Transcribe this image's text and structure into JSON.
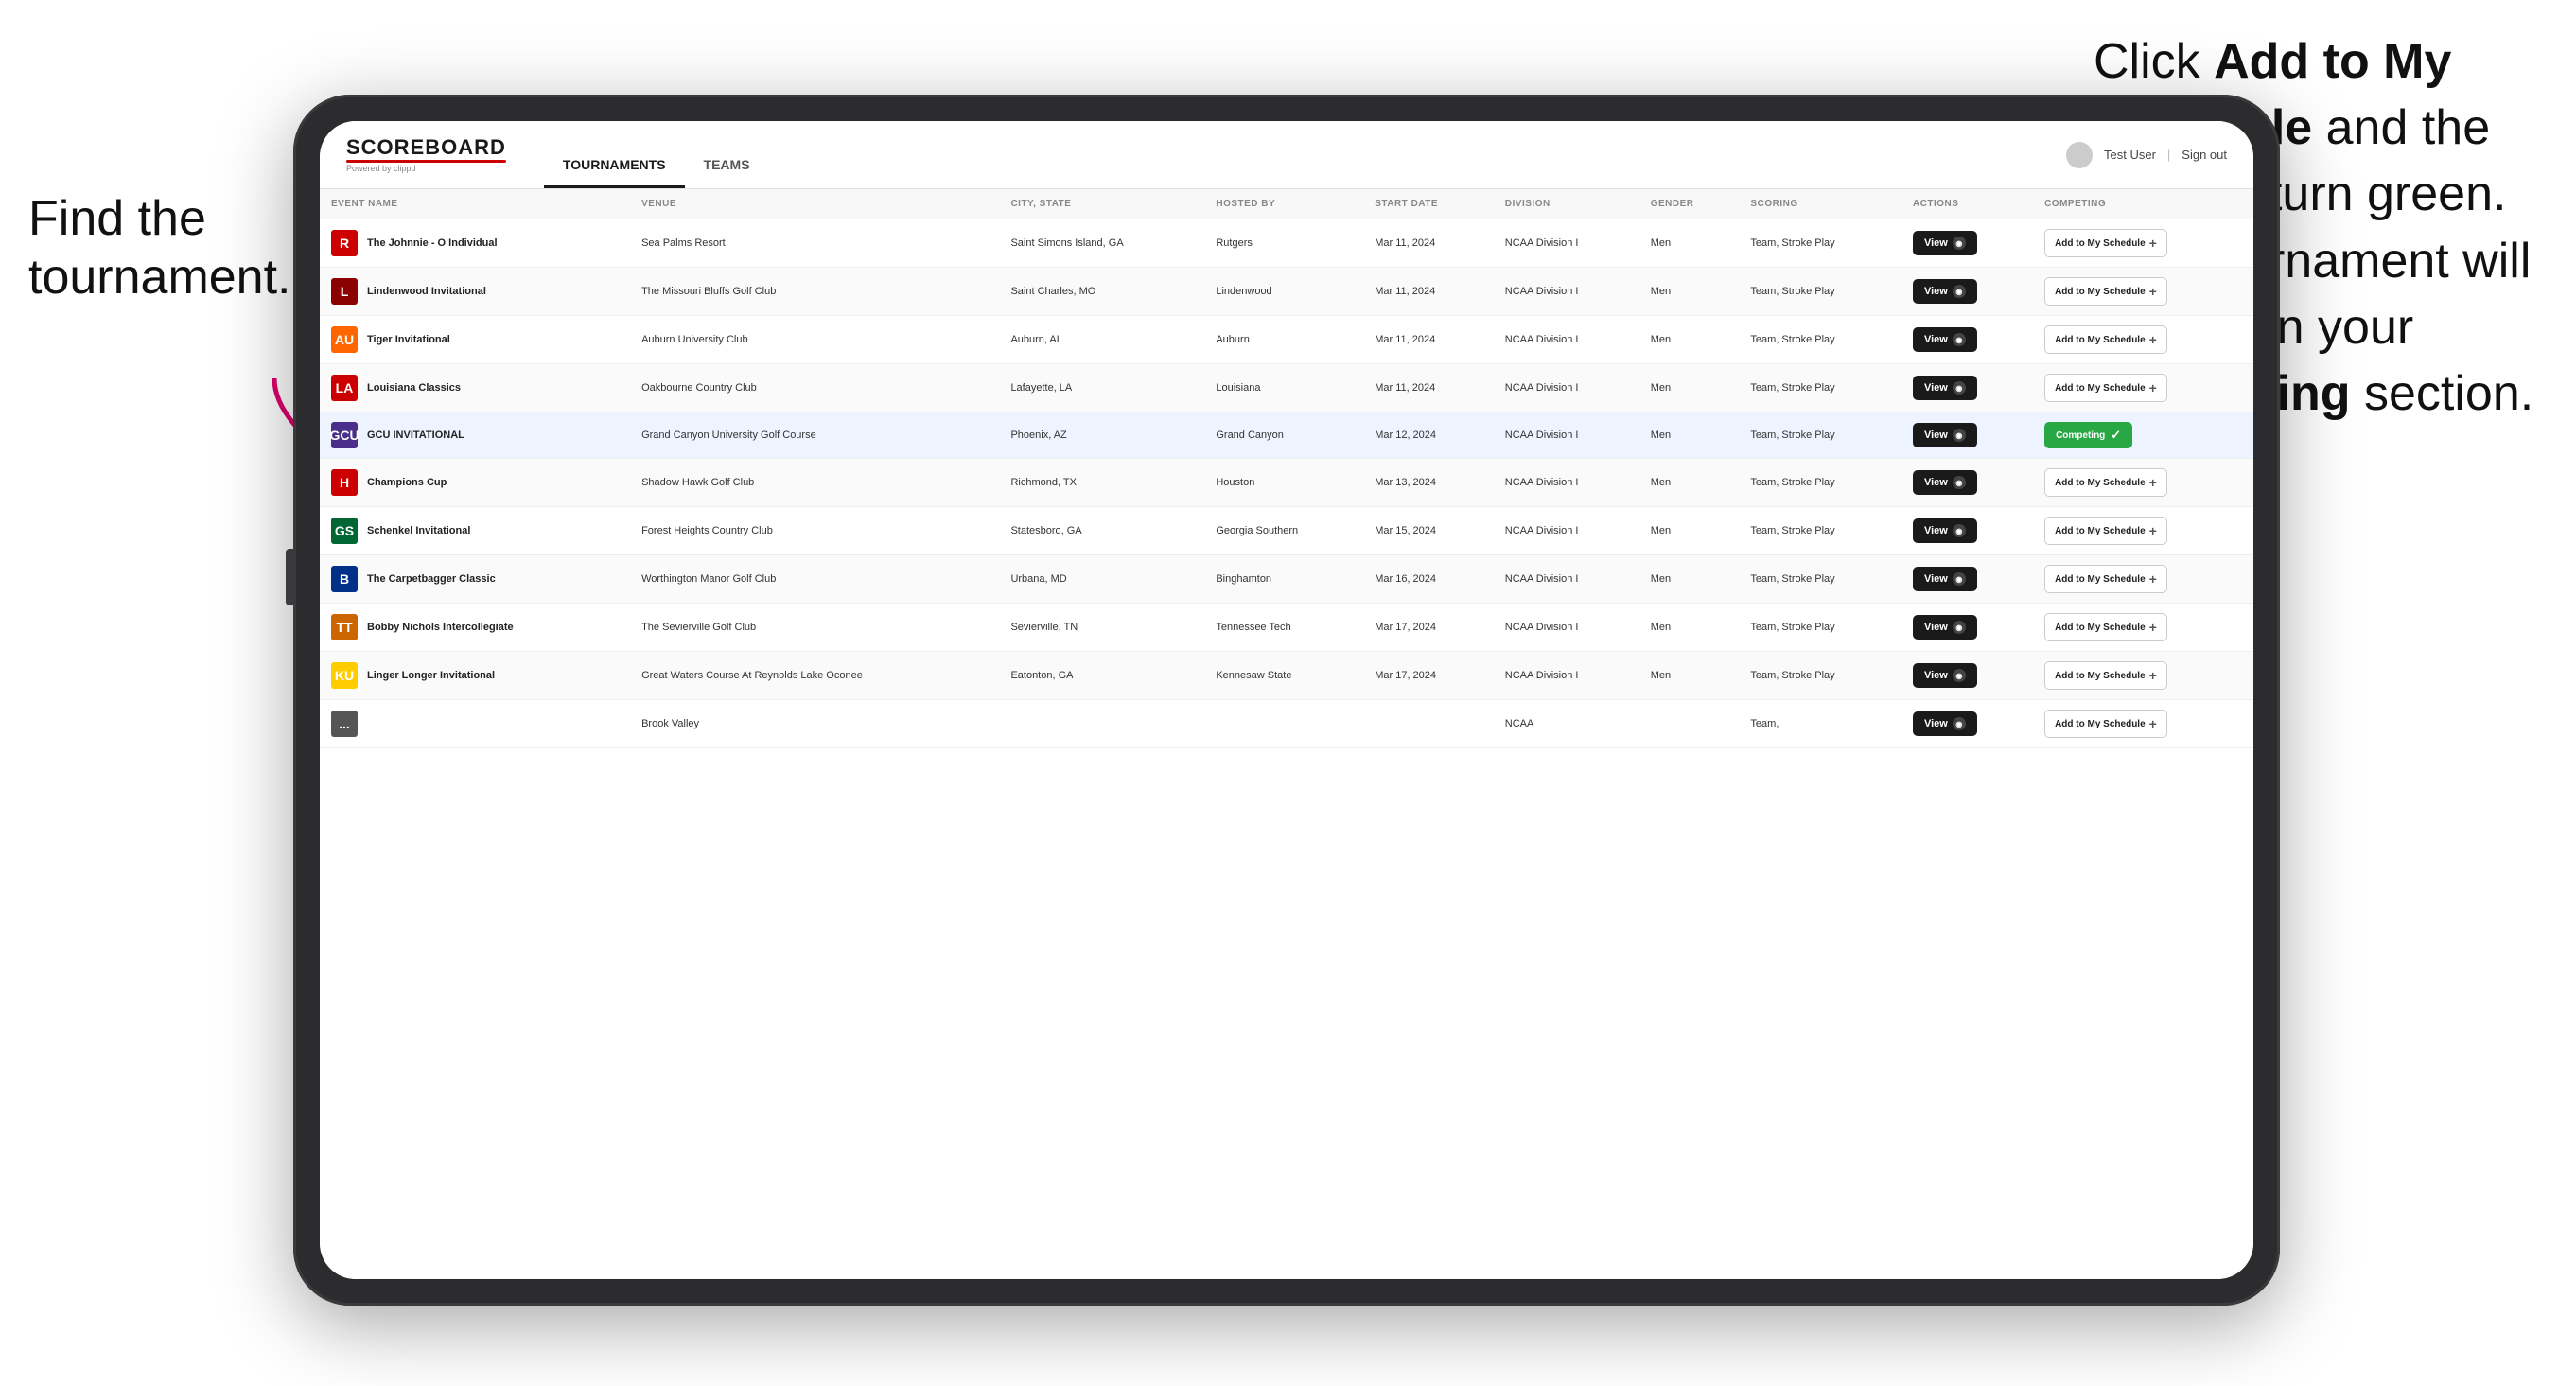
{
  "annotations": {
    "left": "Find the tournament.",
    "right_line1": "Click ",
    "right_bold1": "Add to My Schedule",
    "right_line2": " and the box will turn green. This tournament will now be in your ",
    "right_bold2": "Competing",
    "right_line3": " section."
  },
  "app": {
    "logo": "SCOREBOARD",
    "logo_sub": "Powered by clippd",
    "nav_tabs": [
      "TOURNAMENTS",
      "TEAMS"
    ],
    "active_tab": "TOURNAMENTS",
    "user": "Test User",
    "sign_out": "Sign out"
  },
  "table": {
    "columns": [
      "EVENT NAME",
      "VENUE",
      "CITY, STATE",
      "HOSTED BY",
      "START DATE",
      "DIVISION",
      "GENDER",
      "SCORING",
      "ACTIONS",
      "COMPETING"
    ],
    "rows": [
      {
        "logo_color": "#cc0000",
        "logo_text": "R",
        "event": "The Johnnie - O Individual",
        "venue": "Sea Palms Resort",
        "city_state": "Saint Simons Island, GA",
        "hosted_by": "Rutgers",
        "start_date": "Mar 11, 2024",
        "division": "NCAA Division I",
        "gender": "Men",
        "scoring": "Team, Stroke Play",
        "competing_status": "add",
        "highlighted": false
      },
      {
        "logo_color": "#8B0000",
        "logo_text": "L",
        "event": "Lindenwood Invitational",
        "venue": "The Missouri Bluffs Golf Club",
        "city_state": "Saint Charles, MO",
        "hosted_by": "Lindenwood",
        "start_date": "Mar 11, 2024",
        "division": "NCAA Division I",
        "gender": "Men",
        "scoring": "Team, Stroke Play",
        "competing_status": "add",
        "highlighted": false
      },
      {
        "logo_color": "#FF6600",
        "logo_text": "AU",
        "event": "Tiger Invitational",
        "venue": "Auburn University Club",
        "city_state": "Auburn, AL",
        "hosted_by": "Auburn",
        "start_date": "Mar 11, 2024",
        "division": "NCAA Division I",
        "gender": "Men",
        "scoring": "Team, Stroke Play",
        "competing_status": "add",
        "highlighted": false
      },
      {
        "logo_color": "#cc0000",
        "logo_text": "LA",
        "event": "Louisiana Classics",
        "venue": "Oakbourne Country Club",
        "city_state": "Lafayette, LA",
        "hosted_by": "Louisiana",
        "start_date": "Mar 11, 2024",
        "division": "NCAA Division I",
        "gender": "Men",
        "scoring": "Team, Stroke Play",
        "competing_status": "add",
        "highlighted": false
      },
      {
        "logo_color": "#4a2f8a",
        "logo_text": "GCU",
        "event": "GCU INVITATIONAL",
        "venue": "Grand Canyon University Golf Course",
        "city_state": "Phoenix, AZ",
        "hosted_by": "Grand Canyon",
        "start_date": "Mar 12, 2024",
        "division": "NCAA Division I",
        "gender": "Men",
        "scoring": "Team, Stroke Play",
        "competing_status": "competing",
        "highlighted": true
      },
      {
        "logo_color": "#cc0000",
        "logo_text": "H",
        "event": "Champions Cup",
        "venue": "Shadow Hawk Golf Club",
        "city_state": "Richmond, TX",
        "hosted_by": "Houston",
        "start_date": "Mar 13, 2024",
        "division": "NCAA Division I",
        "gender": "Men",
        "scoring": "Team, Stroke Play",
        "competing_status": "add",
        "highlighted": false
      },
      {
        "logo_color": "#006633",
        "logo_text": "GS",
        "event": "Schenkel Invitational",
        "venue": "Forest Heights Country Club",
        "city_state": "Statesboro, GA",
        "hosted_by": "Georgia Southern",
        "start_date": "Mar 15, 2024",
        "division": "NCAA Division I",
        "gender": "Men",
        "scoring": "Team, Stroke Play",
        "competing_status": "add",
        "highlighted": false
      },
      {
        "logo_color": "#003087",
        "logo_text": "B",
        "event": "The Carpetbagger Classic",
        "venue": "Worthington Manor Golf Club",
        "city_state": "Urbana, MD",
        "hosted_by": "Binghamton",
        "start_date": "Mar 16, 2024",
        "division": "NCAA Division I",
        "gender": "Men",
        "scoring": "Team, Stroke Play",
        "competing_status": "add",
        "highlighted": false
      },
      {
        "logo_color": "#cc6600",
        "logo_text": "TT",
        "event": "Bobby Nichols Intercollegiate",
        "venue": "The Sevierville Golf Club",
        "city_state": "Sevierville, TN",
        "hosted_by": "Tennessee Tech",
        "start_date": "Mar 17, 2024",
        "division": "NCAA Division I",
        "gender": "Men",
        "scoring": "Team, Stroke Play",
        "competing_status": "add",
        "highlighted": false
      },
      {
        "logo_color": "#FFCC00",
        "logo_text": "KU",
        "event": "Linger Longer Invitational",
        "venue": "Great Waters Course At Reynolds Lake Oconee",
        "city_state": "Eatonton, GA",
        "hosted_by": "Kennesaw State",
        "start_date": "Mar 17, 2024",
        "division": "NCAA Division I",
        "gender": "Men",
        "scoring": "Team, Stroke Play",
        "competing_status": "add",
        "highlighted": false
      },
      {
        "logo_color": "#555",
        "logo_text": "...",
        "event": "",
        "venue": "Brook Valley",
        "city_state": "",
        "hosted_by": "",
        "start_date": "",
        "division": "NCAA",
        "gender": "",
        "scoring": "Team,",
        "competing_status": "add",
        "highlighted": false
      }
    ]
  },
  "buttons": {
    "view": "View",
    "add_to_schedule": "Add to My Schedule",
    "competing": "Competing"
  }
}
